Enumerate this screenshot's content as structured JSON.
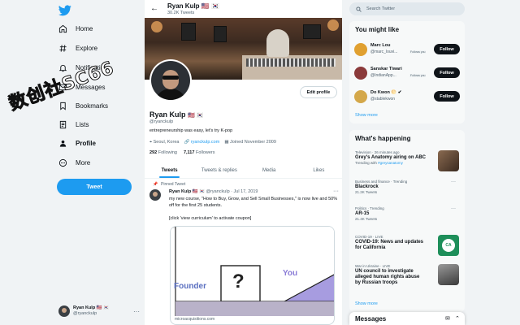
{
  "watermark": "数创社SC66",
  "nav": {
    "items": [
      {
        "label": "Home",
        "icon": "home-icon"
      },
      {
        "label": "Explore",
        "icon": "hashtag-icon"
      },
      {
        "label": "Notifications",
        "icon": "bell-icon"
      },
      {
        "label": "Messages",
        "icon": "envelope-icon"
      },
      {
        "label": "Bookmarks",
        "icon": "bookmark-icon"
      },
      {
        "label": "Lists",
        "icon": "list-icon"
      },
      {
        "label": "Profile",
        "icon": "person-icon"
      },
      {
        "label": "More",
        "icon": "more-circle-icon"
      }
    ],
    "tweet_button": "Tweet",
    "account": {
      "name": "Ryan Kulp",
      "flags": "🇺🇸 🇰🇷",
      "handle": "@ryanckulp",
      "more": "···"
    }
  },
  "header": {
    "back": "←",
    "name": "Ryan Kulp",
    "flags": "🇺🇸 🇰🇷",
    "tweet_count": "30.2K Tweets"
  },
  "profile": {
    "name": "Ryan Kulp",
    "flags": "🇺🇸 🇰🇷",
    "handle": "@ryanckulp",
    "edit_button": "Edit profile",
    "bio": "entrepreneurship was easy, let's try K-pop",
    "location": "Seoul, Korea",
    "website": "ryanckulp.com",
    "joined": "Joined November 2009",
    "following_count": "292",
    "following_label": "Following",
    "followers_count": "7,117",
    "followers_label": "Followers"
  },
  "tabs": [
    "Tweets",
    "Tweets & replies",
    "Media",
    "Likes"
  ],
  "pinned_tweet": {
    "pinned_label": "Pinned Tweet",
    "name": "Ryan Kulp",
    "flags": "🇺🇸 🇰🇷",
    "handle_date": "@ryanckulp · Jul 17, 2019",
    "more": "···",
    "text": "my new course, \"How to Buy, Grow, and Sell Small Businesses,\" is now live and 50% off for the first 25 students.",
    "text2": "[click 'view curriculum' to activate coupon]",
    "card": {
      "label_left": "Founder",
      "label_right": "You",
      "symbol": "?",
      "url": "microacquisitions.com"
    }
  },
  "search": {
    "placeholder": "Search Twitter"
  },
  "who_to_follow": {
    "title": "You might like",
    "users": [
      {
        "name": "Marc Lou",
        "handle": "@marc_louvi...",
        "follows_you": "Follows you",
        "button": "Follow",
        "color": "#e0a030"
      },
      {
        "name": "Sanskar Tiwari",
        "handle": "@IndianApp...",
        "follows_you": "Follows you",
        "button": "Follow",
        "color": "#8b3a3a"
      },
      {
        "name": "Do Kwon 🌕 ✔",
        "handle": "@stablekwon",
        "follows_you": "",
        "button": "Follow",
        "color": "#d4a84a"
      }
    ],
    "show_more": "Show more"
  },
  "happening": {
    "title": "What's happening",
    "trends": [
      {
        "context": "Television · 26 minutes ago",
        "title": "Grey's Anatomy airing on ABC",
        "sub_prefix": "Trending with ",
        "sub_link": "#greysanatomy",
        "has_thumb": true,
        "thumb_color": "#8a6a50"
      },
      {
        "context": "Business and finance · Trending",
        "title": "Blackrock",
        "sub_prefix": "21.2K Tweets",
        "sub_link": "",
        "has_thumb": false,
        "thumb_color": ""
      },
      {
        "context": "Politics · Trending",
        "title": "AR-15",
        "sub_prefix": "21.4K Tweets",
        "sub_link": "",
        "has_thumb": false,
        "thumb_color": ""
      },
      {
        "context": "COVID-19 · LIVE",
        "title": "COVID-19: News and updates for California",
        "sub_prefix": "",
        "sub_link": "",
        "has_thumb": true,
        "thumb_color": "#1e8f5a",
        "thumb_text": "CA"
      },
      {
        "context": "War in Ukraine · LIVE",
        "title": "UN council to investigate alleged human rights abuse by Russian troops",
        "sub_prefix": "",
        "sub_link": "",
        "has_thumb": true,
        "thumb_color": "#6a6a6a"
      }
    ],
    "show_more": "Show more"
  },
  "messages": {
    "title": "Messages"
  },
  "colors": {
    "accent": "#1d9bf0",
    "text": "#0f1419",
    "muted": "#536471"
  }
}
